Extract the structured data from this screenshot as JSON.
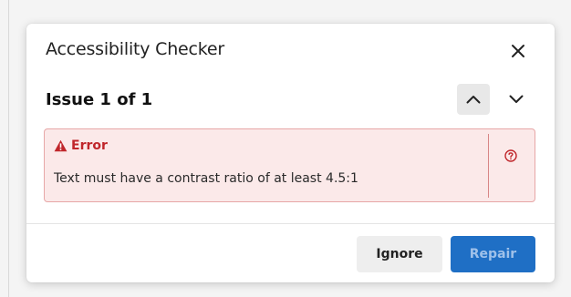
{
  "dialog": {
    "title": "Accessibility Checker",
    "close_icon": "close-icon"
  },
  "issue": {
    "title": "Issue 1 of 1",
    "prev_icon": "chevron-up-icon",
    "next_icon": "chevron-down-icon"
  },
  "error": {
    "label": "Error",
    "icon": "warning-triangle-icon",
    "message": "Text must have a contrast ratio of at least 4.5:1",
    "help_icon": "help-circle-icon"
  },
  "footer": {
    "ignore_label": "Ignore",
    "repair_label": "Repair",
    "repair_disabled": true
  },
  "colors": {
    "error_text": "#c0262b",
    "error_bg": "#fbe9e9",
    "error_border": "#e7a7a7",
    "primary_button": "#1f6fc5",
    "secondary_button": "#eeeeee"
  }
}
